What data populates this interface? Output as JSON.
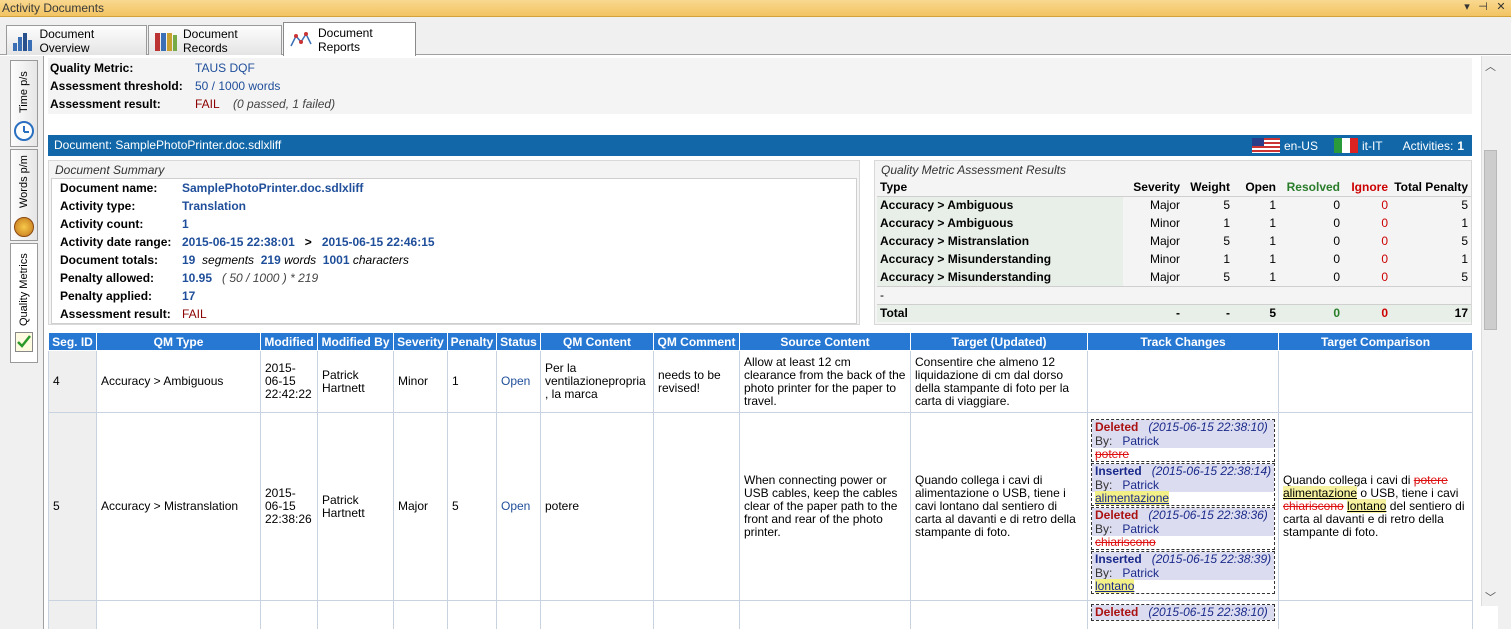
{
  "window": {
    "title": "Activity Documents",
    "ctl_menu": "▾",
    "ctl_pin": "⊣",
    "ctl_close": "✕"
  },
  "tabs": [
    {
      "label": "Document Overview"
    },
    {
      "label": "Document Records"
    },
    {
      "label": "Document Reports"
    }
  ],
  "side_tabs": [
    {
      "label": "Time p/s"
    },
    {
      "label": "Words p/m"
    },
    {
      "label": "Quality Metrics"
    }
  ],
  "qm_info": {
    "metric_label": "Quality Metric:",
    "metric_value": "TAUS DQF",
    "threshold_label": "Assessment threshold:",
    "threshold_value": "50 / 1000 words",
    "result_label": "Assessment result:",
    "result_value": "FAIL",
    "result_note": "(0 passed, 1 failed)"
  },
  "document_header": {
    "document": "Document: SamplePhotoPrinter.doc.sdlxliff",
    "source_lang": "en-US",
    "target_lang": "it-IT",
    "activities_label": "Activities:",
    "activities_value": "1"
  },
  "summary": {
    "caption": "Document Summary",
    "name_label": "Document name:",
    "name_value": "SamplePhotoPrinter.doc.sdlxliff",
    "type_label": "Activity type:",
    "type_value": "Translation",
    "count_label": "Activity count:",
    "count_value": "1",
    "range_label": "Activity date range:",
    "range_start": "2015-06-15 22:38:01",
    "range_sep": ">",
    "range_end": "2015-06-15 22:46:15",
    "totals_label": "Document totals:",
    "totals_segments": "19",
    "segments_word": "segments",
    "totals_words": "219",
    "words_word": "words",
    "totals_chars": "1001",
    "chars_word": "characters",
    "penalty_allowed_label": "Penalty allowed:",
    "penalty_allowed_value": "10.95",
    "penalty_allowed_formula": "( 50 / 1000 ) * 219",
    "penalty_applied_label": "Penalty applied:",
    "penalty_applied_value": "17",
    "result_label": "Assessment result:",
    "result_value": "FAIL"
  },
  "qm_results": {
    "caption": "Quality Metric Assessment Results",
    "headers": {
      "type": "Type",
      "severity": "Severity",
      "weight": "Weight",
      "open": "Open",
      "resolved": "Resolved",
      "ignore": "Ignore",
      "total": "Total Penalty"
    },
    "rows": [
      {
        "type": "Accuracy > Ambiguous",
        "severity": "Major",
        "weight": "5",
        "open": "1",
        "resolved": "0",
        "ignore": "0",
        "total": "5"
      },
      {
        "type": "Accuracy > Ambiguous",
        "severity": "Minor",
        "weight": "1",
        "open": "1",
        "resolved": "0",
        "ignore": "0",
        "total": "1"
      },
      {
        "type": "Accuracy > Mistranslation",
        "severity": "Major",
        "weight": "5",
        "open": "1",
        "resolved": "0",
        "ignore": "0",
        "total": "5"
      },
      {
        "type": "Accuracy > Misunderstanding",
        "severity": "Minor",
        "weight": "1",
        "open": "1",
        "resolved": "0",
        "ignore": "0",
        "total": "1"
      },
      {
        "type": "Accuracy > Misunderstanding",
        "severity": "Major",
        "weight": "5",
        "open": "1",
        "resolved": "0",
        "ignore": "0",
        "total": "5"
      }
    ],
    "dash": "-",
    "total": {
      "label": "Total",
      "severity": "-",
      "weight": "-",
      "open": "5",
      "resolved": "0",
      "ignore": "0",
      "total": "17"
    }
  },
  "segments": {
    "headers": [
      "Seg. ID",
      "QM Type",
      "Modified",
      "Modified By",
      "Severity",
      "Penalty",
      "Status",
      "QM Content",
      "QM Comment",
      "Source Content",
      "Target (Updated)",
      "Track Changes",
      "Target Comparison"
    ],
    "row1": {
      "id": "4",
      "qm_type": "Accuracy > Ambiguous",
      "modified": "2015-06-15 22:42:22",
      "modified_by": "Patrick Hartnett",
      "severity": "Minor",
      "penalty": "1",
      "status": "Open",
      "qm_content": "Per la ventilazionepropria, la marca",
      "qm_comment": "needs to be revised!",
      "source": "Allow at least 12 cm clearance from the back of the photo printer for the paper to travel.",
      "target": "Consentire che almeno 12 liquidazione di cm dal dorso della stampante di foto per la carta di viaggiare."
    },
    "row2": {
      "id": "5",
      "qm_type": "Accuracy > Mistranslation",
      "modified": "2015-06-15 22:38:26",
      "modified_by": "Patrick Hartnett",
      "severity": "Major",
      "penalty": "5",
      "status": "Open",
      "qm_content": "potere",
      "qm_comment": "",
      "source": "When connecting power or USB cables, keep the cables clear of the paper path to the front and rear of the photo printer.",
      "target": "Quando collega i cavi di alimentazione o USB, tiene i cavi lontano dal sentiero di carta al davanti e di retro della stampante di foto.",
      "changes": [
        {
          "kind": "Deleted",
          "date": "(2015-06-15 22:38:10)",
          "by_label": "By:",
          "by": "Patrick",
          "text": "potere"
        },
        {
          "kind": "Inserted",
          "date": "(2015-06-15 22:38:14)",
          "by_label": "By:",
          "by": "Patrick",
          "text": "alimentazione"
        },
        {
          "kind": "Deleted",
          "date": "(2015-06-15 22:38:36)",
          "by_label": "By:",
          "by": "Patrick",
          "text": "chiariscono"
        },
        {
          "kind": "Inserted",
          "date": "(2015-06-15 22:38:39)",
          "by_label": "By:",
          "by": "Patrick",
          "text": "lontano"
        }
      ],
      "comparison": {
        "p1": "Quando collega i cavi di",
        "del1": "potere",
        "ins1": "alimentazione",
        "p2": "o USB, tiene i cavi",
        "del2": "chiariscono",
        "ins2": "lontano",
        "p3": "del sentiero di carta al davanti e di retro della stampante di foto."
      }
    },
    "row3": {
      "change": {
        "kind": "Deleted",
        "date": "(2015-06-15 22:38:10)"
      }
    }
  },
  "colors": {
    "header_blue": "#1167a8",
    "column_blue": "#2778d3",
    "fail": "#8b0000",
    "value_blue": "#1f4e9a"
  }
}
